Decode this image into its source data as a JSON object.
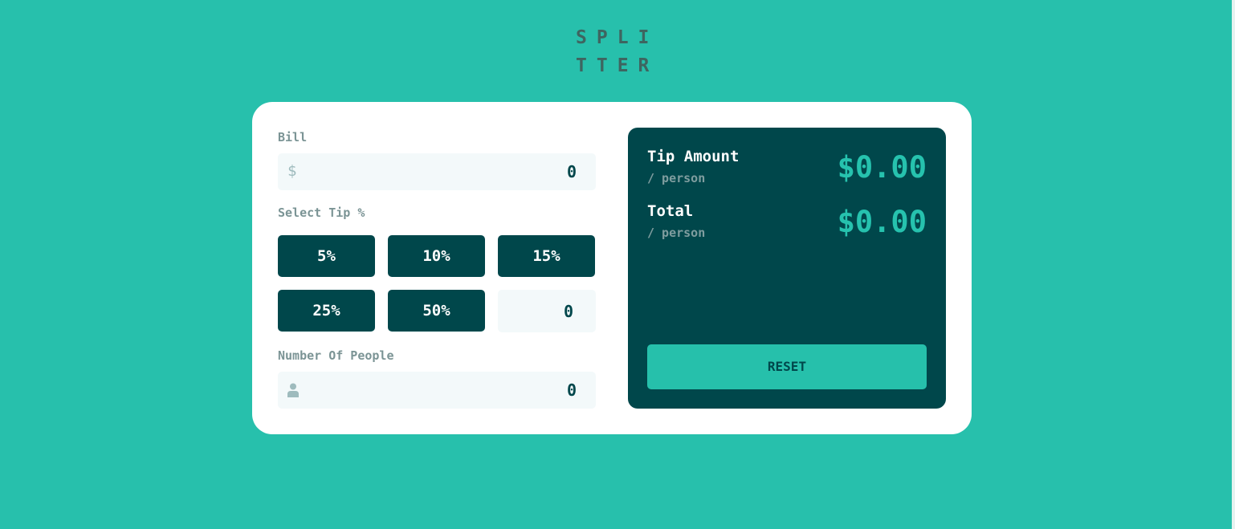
{
  "logo": {
    "line1": "SPLI",
    "line2": "TTER"
  },
  "bill": {
    "label": "Bill",
    "value": "0",
    "icon": "dollar-icon"
  },
  "tip": {
    "label": "Select Tip %",
    "options": [
      "5%",
      "10%",
      "15%",
      "25%",
      "50%"
    ],
    "custom_value": "0"
  },
  "people": {
    "label": "Number Of People",
    "value": "0",
    "icon": "person-icon"
  },
  "results": {
    "tip_amount": {
      "label": "Tip Amount",
      "sub": "/ person",
      "value": "$0.00"
    },
    "total": {
      "label": "Total",
      "sub": "/ person",
      "value": "$0.00"
    },
    "reset_label": "RESET"
  },
  "colors": {
    "background": "#27c0ac",
    "dark": "#00474b",
    "accent": "#26c2ae",
    "input_bg": "#f3f9fa"
  }
}
